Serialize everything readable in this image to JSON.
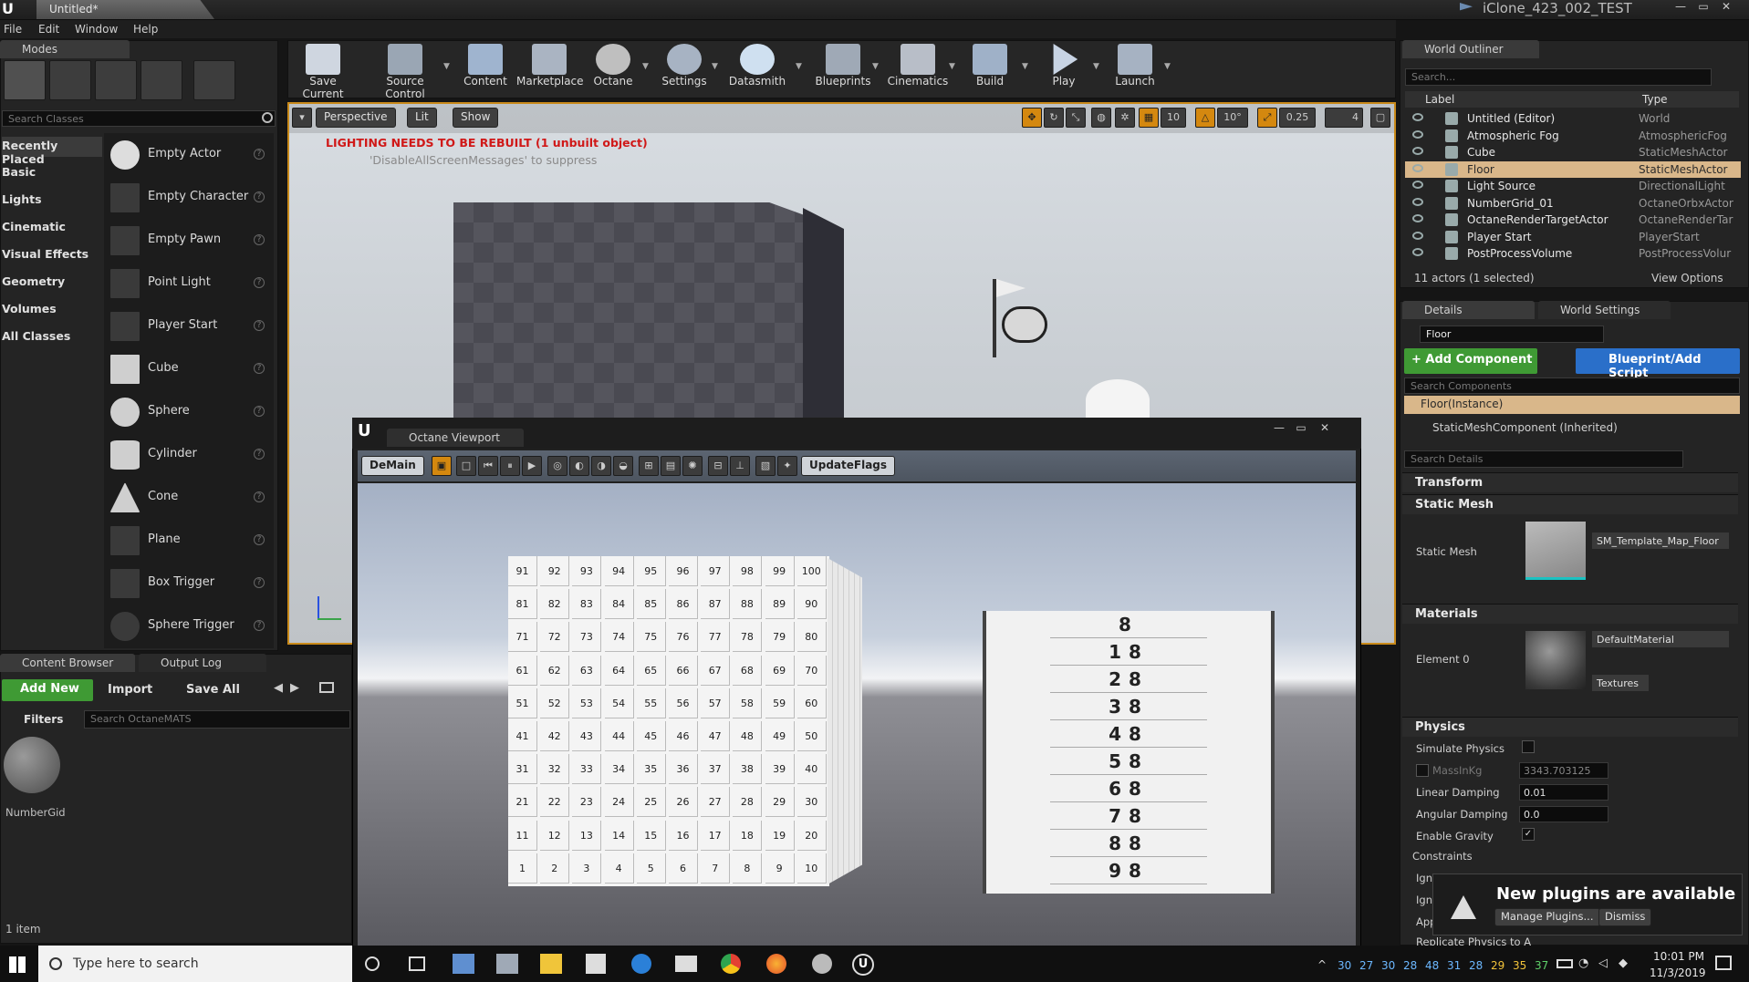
{
  "window": {
    "tab_title": "Untitled*",
    "project": "iClone_423_002_TEST"
  },
  "menu": [
    "File",
    "Edit",
    "Window",
    "Help"
  ],
  "modes": {
    "tab": "Modes",
    "search_placeholder": "Search Classes",
    "categories": [
      "Recently Placed",
      "Basic",
      "Lights",
      "Cinematic",
      "Visual Effects",
      "Geometry",
      "Volumes",
      "All Classes"
    ],
    "items": [
      "Empty Actor",
      "Empty Character",
      "Empty Pawn",
      "Point Light",
      "Player Start",
      "Cube",
      "Sphere",
      "Cylinder",
      "Cone",
      "Plane",
      "Box Trigger",
      "Sphere Trigger"
    ]
  },
  "toolbar": [
    {
      "label": "Save Current",
      "icon": "save-icon"
    },
    {
      "label": "Source Control",
      "icon": "source-control-icon"
    },
    {
      "label": "Content",
      "icon": "content-icon"
    },
    {
      "label": "Marketplace",
      "icon": "marketplace-icon"
    },
    {
      "label": "Octane",
      "icon": "octane-icon"
    },
    {
      "label": "Settings",
      "icon": "settings-icon"
    },
    {
      "label": "Datasmith",
      "icon": "datasmith-icon"
    },
    {
      "label": "Blueprints",
      "icon": "blueprints-icon"
    },
    {
      "label": "Cinematics",
      "icon": "cinematics-icon"
    },
    {
      "label": "Build",
      "icon": "build-icon"
    },
    {
      "label": "Play",
      "icon": "play-icon"
    },
    {
      "label": "Launch",
      "icon": "launch-icon"
    }
  ],
  "viewport": {
    "perspective": "Perspective",
    "lit": "Lit",
    "show": "Show",
    "warning": "LIGHTING NEEDS TO BE REBUILT (1 unbuilt object)",
    "suppress": "'DisableAllScreenMessages' to suppress",
    "grid_snap": "10",
    "rot_snap": "10°",
    "scale_snap": "0.25",
    "cam_speed": "4"
  },
  "octane": {
    "tab": "Octane Viewport",
    "demain": "DeMain",
    "update_flags": "UpdateFlags",
    "grid_rows": [
      [
        "91",
        "92",
        "93",
        "94",
        "95",
        "96",
        "97",
        "98",
        "99",
        "100"
      ],
      [
        "81",
        "82",
        "83",
        "84",
        "85",
        "86",
        "87",
        "88",
        "89",
        "90"
      ],
      [
        "71",
        "72",
        "73",
        "74",
        "75",
        "76",
        "77",
        "78",
        "79",
        "80"
      ],
      [
        "61",
        "62",
        "63",
        "64",
        "65",
        "66",
        "67",
        "68",
        "69",
        "70"
      ],
      [
        "51",
        "52",
        "53",
        "54",
        "55",
        "56",
        "57",
        "58",
        "59",
        "60"
      ],
      [
        "41",
        "42",
        "43",
        "44",
        "45",
        "46",
        "47",
        "48",
        "49",
        "50"
      ],
      [
        "31",
        "32",
        "33",
        "34",
        "35",
        "36",
        "37",
        "38",
        "39",
        "40"
      ],
      [
        "21",
        "22",
        "23",
        "24",
        "25",
        "26",
        "27",
        "28",
        "29",
        "30"
      ],
      [
        "11",
        "12",
        "13",
        "14",
        "15",
        "16",
        "17",
        "18",
        "19",
        "20"
      ],
      [
        "1",
        "2",
        "3",
        "4",
        "5",
        "6",
        "7",
        "8",
        "9",
        "10"
      ]
    ],
    "dial_rows": [
      "8",
      "18",
      "28",
      "38",
      "48",
      "58",
      "68",
      "78",
      "88",
      "98"
    ]
  },
  "content_browser": {
    "tab": "Content Browser",
    "output_tab": "Output Log",
    "add_new": "Add New",
    "import": "Import",
    "save_all": "Save All",
    "filters": "Filters",
    "search_placeholder": "Search OctaneMATS",
    "asset": "NumberGid",
    "count": "1 item"
  },
  "outliner": {
    "tab": "World Outliner",
    "search_placeholder": "Search...",
    "col_label": "Label",
    "col_type": "Type",
    "rows": [
      {
        "name": "Untitled (Editor)",
        "type": "World"
      },
      {
        "name": "Atmospheric Fog",
        "type": "AtmosphericFog"
      },
      {
        "name": "Cube",
        "type": "StaticMeshActor"
      },
      {
        "name": "Floor",
        "type": "StaticMeshActor",
        "selected": true
      },
      {
        "name": "Light Source",
        "type": "DirectionalLight"
      },
      {
        "name": "NumberGrid_01",
        "type": "OctaneOrbxActor"
      },
      {
        "name": "OctaneRenderTargetActor",
        "type": "OctaneRenderTar"
      },
      {
        "name": "Player Start",
        "type": "PlayerStart"
      },
      {
        "name": "PostProcessVolume",
        "type": "PostProcessVolur"
      }
    ],
    "status": "11 actors (1 selected)",
    "view_options": "View Options"
  },
  "details": {
    "tab": "Details",
    "world_tab": "World Settings",
    "name": "Floor",
    "add_component": "+ Add Component",
    "blueprint": "Blueprint/Add Script",
    "search_components": "Search Components",
    "instance": "Floor(Instance)",
    "mesh_component": "StaticMeshComponent (Inherited)",
    "search_details": "Search Details",
    "sections": {
      "transform": "Transform",
      "static_mesh": "Static Mesh",
      "materials": "Materials",
      "physics": "Physics"
    },
    "static_mesh_label": "Static Mesh",
    "static_mesh_value": "SM_Template_Map_Floor",
    "element0": "Element 0",
    "material": "DefaultMaterial",
    "textures": "Textures",
    "simulate": "Simulate Physics",
    "mass": "MassInKg",
    "mass_value": "3343.703125",
    "linear": "Linear Damping",
    "linear_value": "0.01",
    "angular": "Angular Damping",
    "angular_value": "0.0",
    "gravity": "Enable Gravity",
    "constraints": "Constraints",
    "ign1": "Igno",
    "ign2": "Igno",
    "app": "App",
    "replicate": "Replicate Physics to A"
  },
  "notification": {
    "title": "New plugins are available",
    "manage": "Manage Plugins...",
    "dismiss": "Dismiss"
  },
  "taskbar": {
    "search": "Type here to search",
    "time": "10:01 PM",
    "date": "11/3/2019",
    "temps": [
      "30",
      "27",
      "30",
      "28",
      "48",
      "31",
      "28",
      "29",
      "35",
      "37"
    ]
  }
}
